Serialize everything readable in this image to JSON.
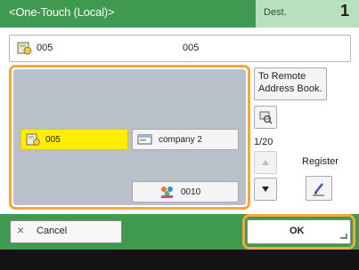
{
  "header": {
    "title": "<One-Touch (Local)>",
    "dest_label": "Dest.",
    "dest_count": "1"
  },
  "address_field": {
    "text": "005",
    "name": "005",
    "icon": "address-book-card-icon"
  },
  "destinations": [
    {
      "label": "005",
      "selected": true,
      "icon": "address-book-card-icon"
    },
    {
      "label": "company 2",
      "selected": false,
      "icon": "group-window-icon"
    },
    {
      "label": "0010",
      "selected": false,
      "icon": "group-people-icon"
    }
  ],
  "controls": {
    "remote_line1": "To Remote",
    "remote_line2": "Address Book.",
    "page_indicator": "1/20",
    "register_label": "Register"
  },
  "footer": {
    "cancel_label": "Cancel",
    "ok_label": "OK"
  },
  "colors": {
    "header_green": "#3f9a4f",
    "dest_tab": "#b7e0bd",
    "selected_yellow": "#ffee00",
    "focus_orange": "#f2a93b",
    "grid_panel": "#b9c0ca"
  }
}
